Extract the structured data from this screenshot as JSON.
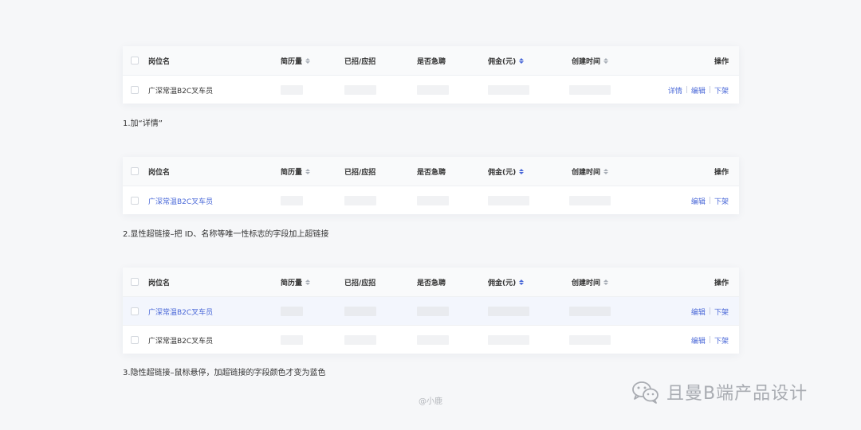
{
  "columns": {
    "name": "岗位名",
    "resume": "简历量",
    "hired": "已招/应招",
    "urgent": "是否急聘",
    "commission": "佣金(元)",
    "created": "创建时间",
    "ops": "操作"
  },
  "row_name": "广深常温B2C叉车员",
  "ops": {
    "detail": "详情",
    "edit": "编辑",
    "offline": "下架",
    "separator": "|"
  },
  "captions": {
    "c1": "1.加“详情”",
    "c2": "2.显性超链接–把 ID、名称等唯一性标志的字段加上超链接",
    "c3": "3.隐性超链接–鼠标悬停，加超链接的字段颜色才变为蓝色"
  },
  "credit": "@小鹿",
  "brand": "且曼B端产品设计",
  "colors": {
    "link": "#4a68d8",
    "hover_row": "#f3f6fd",
    "header_bg": "#f9fafb"
  }
}
